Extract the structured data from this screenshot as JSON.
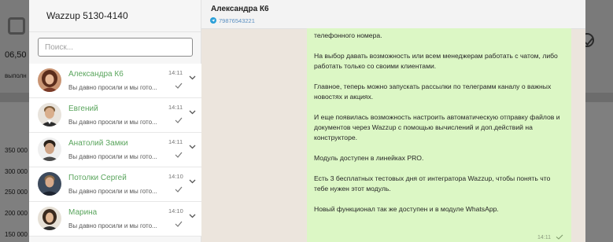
{
  "background": {
    "price": "06,50",
    "subtext": "выполн",
    "axis_labels": [
      "350 000",
      "300 000",
      "250 000",
      "200 000",
      "150 000"
    ]
  },
  "sidebar": {
    "account": "Wazzup 5130-4140",
    "search_placeholder": "Поиск...",
    "chats": [
      {
        "name": "Александра К6",
        "time": "14:11",
        "preview": "Вы давно просили и мы гото...",
        "avatar": "avatar-woman-1"
      },
      {
        "name": "Евгений",
        "time": "14:11",
        "preview": "Вы давно просили и мы гото...",
        "avatar": "avatar-man-1"
      },
      {
        "name": "Анатолий Замки",
        "time": "14:11",
        "preview": "Вы давно просили и мы гото...",
        "avatar": "avatar-man-2"
      },
      {
        "name": "Потолки Сергей",
        "time": "14:10",
        "preview": "Вы давно просили и мы гото...",
        "avatar": "avatar-man-3"
      },
      {
        "name": "Марина",
        "time": "14:10",
        "preview": "Вы давно просили и мы гото...",
        "avatar": "avatar-woman-2"
      }
    ]
  },
  "conversation": {
    "contact_name": "Александра К6",
    "contact_phone": "79876543221",
    "message": {
      "paragraphs": [
        "телефонного номера.",
        "На выбор давать возможность или всем менеджерам работать с чатом, либо работать только со своими клиентами.",
        "Главное, теперь можно запускать рассылки по телеграмм каналу о важных новостях и акциях.",
        "И еще появилась возможность настроить автоматическую отправку файлов и документов через Wazzup с помощью вычислений и доп.действий на конструкторе.",
        "Модуль доступен в линейках PRO.",
        "Есть 3 бесплатных тестовых дня от интегратора Wazzup, чтобы понять что тебе нужен этот модуль.",
        "Новый функционал так же доступен и в модуле WhatsApp."
      ],
      "time": "14:11"
    }
  },
  "colors": {
    "contact_name": "#5aa55d",
    "bubble": "#dcf7c5",
    "chat_background": "#ece5dd",
    "telegram": "#2a9fd8"
  }
}
